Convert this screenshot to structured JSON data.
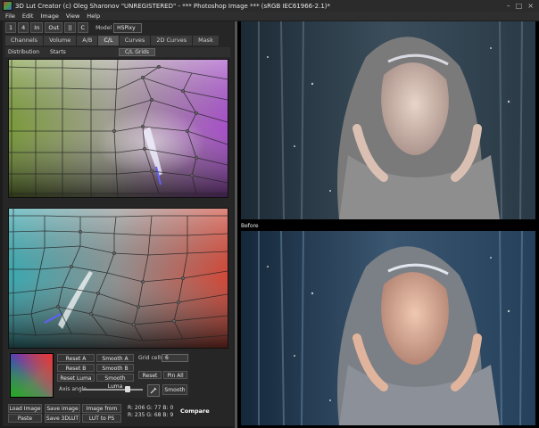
{
  "window": {
    "title": "3D Lut Creator (c) Oleg Sharonov \"UNREGISTERED\" - *** Photoshop Image *** (sRGB IEC61966-2.1)*",
    "controls": [
      "–",
      "□",
      "×"
    ]
  },
  "menu": [
    "File",
    "Edit",
    "Image",
    "View",
    "Help"
  ],
  "toolbar": {
    "buttons": [
      "1",
      "4",
      "In",
      "Out",
      "||",
      "C"
    ],
    "model_label": "Model",
    "model_value": "HSPixy"
  },
  "tabs": [
    {
      "label": "Channels",
      "active": false
    },
    {
      "label": "Volume",
      "active": false
    },
    {
      "label": "A/B",
      "active": false
    },
    {
      "label": "C/L",
      "active": true
    },
    {
      "label": "Curves",
      "active": false
    },
    {
      "label": "2D Curves",
      "active": false
    },
    {
      "label": "Mask",
      "active": false
    }
  ],
  "subtabs": {
    "distribution": "Distribution",
    "starts": "Starts",
    "cl_grids": "C/L Grids"
  },
  "controls": {
    "reset_a": "Reset A",
    "smooth_a": "Smooth A",
    "reset_b": "Reset B",
    "smooth_b": "Smooth B",
    "reset_luma": "Reset Luma",
    "smooth_luma": "Smooth Luma",
    "grid_cells_label": "Grid cells",
    "grid_cells_value": "6",
    "reset": "Reset",
    "pin_all": "Pin All",
    "smooth": "Smooth",
    "axis_angle_label": "Axis angle",
    "axis_angle": 0.75
  },
  "footer": {
    "load_image": "Load Image",
    "save_image": "Save image",
    "image_from_ps": "Image from PS",
    "paste": "Paste",
    "save_3dlut": "Save 3DLUT",
    "lut_to_ps": "LUT to PS",
    "readout_line1": "R: 206  G: 77  B: 0",
    "readout_line2": "R: 235  G: 68  B: 9",
    "compare": "Compare"
  },
  "preview": {
    "before_label": "Before"
  },
  "colors": {
    "panel_bg": "#262626",
    "accent_purple": "#a040c0",
    "accent_red": "#c04030",
    "accent_cyan": "#40a0b0"
  }
}
